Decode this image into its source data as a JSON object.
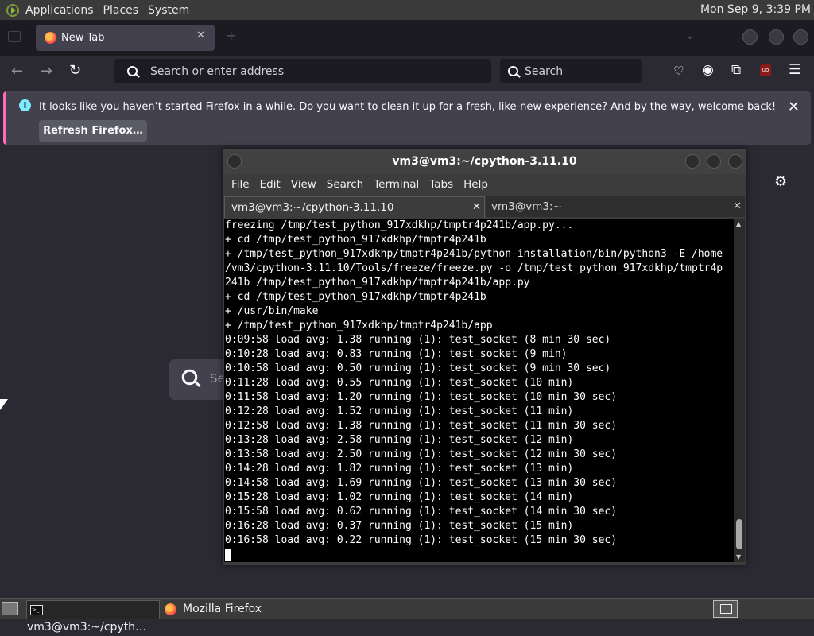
{
  "top_panel": {
    "menus": [
      "Applications",
      "Places",
      "System"
    ],
    "clock": "Mon Sep  9,  3:39 PM"
  },
  "firefox": {
    "tab_title": "New Tab",
    "url_placeholder": "Search or enter address",
    "search_placeholder": "Search",
    "notification": {
      "message": "It looks like you haven’t started Firefox in a while. Do you want to clean it up for a fresh, like-new experience? And by the way, welcome back!",
      "button_label": "Refresh Firefox…"
    },
    "newtab_search_text": "Se"
  },
  "terminal": {
    "title": "vm3@vm3:~/cpython-3.11.10",
    "menus": [
      "File",
      "Edit",
      "View",
      "Search",
      "Terminal",
      "Tabs",
      "Help"
    ],
    "tabs": [
      {
        "label": "vm3@vm3:~/cpython-3.11.10",
        "active": true
      },
      {
        "label": "vm3@vm3:~",
        "active": false
      }
    ],
    "lines": [
      "freezing /tmp/test_python_917xdkhp/tmptr4p241b/app.py...",
      "+ cd /tmp/test_python_917xdkhp/tmptr4p241b",
      "+ /tmp/test_python_917xdkhp/tmptr4p241b/python-installation/bin/python3 -E /home",
      "/vm3/cpython-3.11.10/Tools/freeze/freeze.py -o /tmp/test_python_917xdkhp/tmptr4p",
      "241b /tmp/test_python_917xdkhp/tmptr4p241b/app.py",
      "+ cd /tmp/test_python_917xdkhp/tmptr4p241b",
      "+ /usr/bin/make",
      "+ /tmp/test_python_917xdkhp/tmptr4p241b/app",
      "0:09:58 load avg: 1.38 running (1): test_socket (8 min 30 sec)",
      "0:10:28 load avg: 0.83 running (1): test_socket (9 min)",
      "0:10:58 load avg: 0.50 running (1): test_socket (9 min 30 sec)",
      "0:11:28 load avg: 0.55 running (1): test_socket (10 min)",
      "0:11:58 load avg: 1.20 running (1): test_socket (10 min 30 sec)",
      "0:12:28 load avg: 1.52 running (1): test_socket (11 min)",
      "0:12:58 load avg: 1.38 running (1): test_socket (11 min 30 sec)",
      "0:13:28 load avg: 2.58 running (1): test_socket (12 min)",
      "0:13:58 load avg: 2.50 running (1): test_socket (12 min 30 sec)",
      "0:14:28 load avg: 1.82 running (1): test_socket (13 min)",
      "0:14:58 load avg: 1.69 running (1): test_socket (13 min 30 sec)",
      "0:15:28 load avg: 1.02 running (1): test_socket (14 min)",
      "0:15:58 load avg: 0.62 running (1): test_socket (14 min 30 sec)",
      "0:16:28 load avg: 0.37 running (1): test_socket (15 min)",
      "0:16:58 load avg: 0.22 running (1): test_socket (15 min 30 sec)"
    ]
  },
  "taskbar": {
    "items": [
      {
        "label": "vm3@vm3:~/cpyth…",
        "icon": "terminal-icon",
        "active": true
      },
      {
        "label": "Mozilla Firefox",
        "icon": "firefox-icon",
        "active": false
      }
    ]
  },
  "colors": {
    "firefox_bg": "#2b2a33",
    "firefox_tabbar": "#1c1b22",
    "notification_accent": "#ff6bba",
    "terminal_bg": "#000000"
  }
}
